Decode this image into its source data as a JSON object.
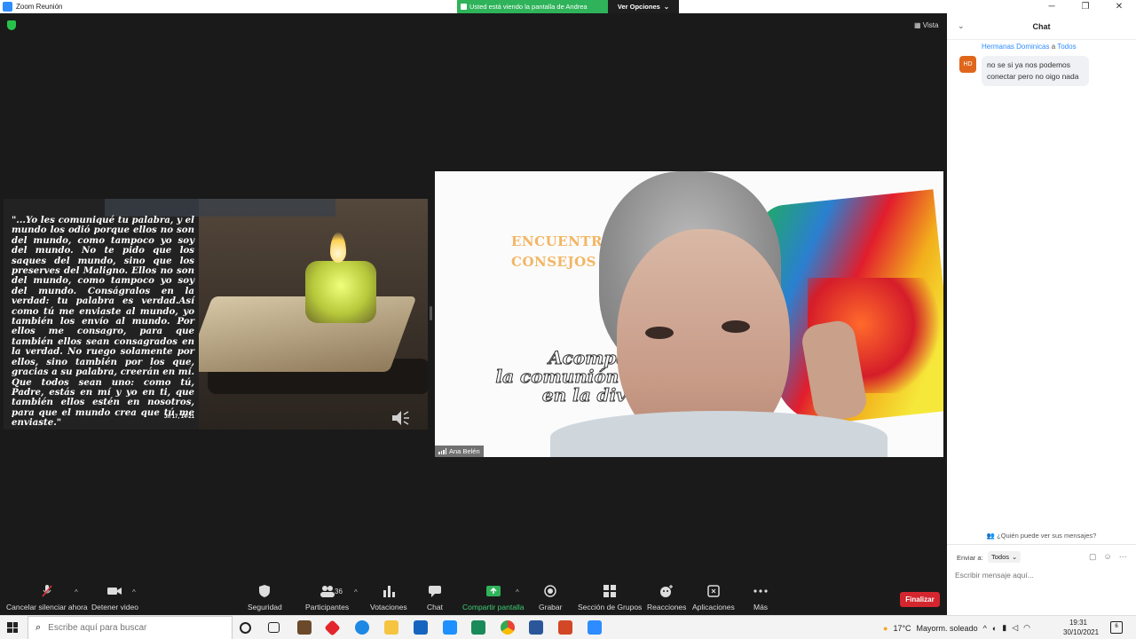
{
  "window": {
    "title": "Zoom Reunión",
    "share_banner": "Usted está viendo la pantalla de Andrea",
    "view_options": "Ver Opciones",
    "view_label": "Vista"
  },
  "shared_slide": {
    "verse": "\"...Yo les comuniqué tu palabra, y el mundo los odió porque ellos no son del mundo, como tampoco yo soy del mundo. No te pido que los saques del mundo, sino que los preserves del Maligno. Ellos no son del mundo, como tampoco yo soy del mundo. Conságralos en la verdad: tu palabra es verdad.Así como tú me enviaste al mundo, yo también los envío al mundo. Por ellos me consagro, para que también ellos sean consagrados en la verdad. No ruego solamente por ellos, sino también por los que, gracias a su palabra, creerán en mí. Que todos sean uno: como tú, Padre, estás en mí y yo en ti, que también ellos estén en nosotros, para que el mundo crea que tú me enviaste.\"",
    "reference": "Jn 17, 14-21"
  },
  "video_tile": {
    "participant_name": "Ana Belén",
    "bg_line1": "ENCUENTRO",
    "bg_line2": "CONSEJOS 2",
    "bg_phrase_1": "Acompañ",
    "bg_phrase_2": "la comunión congre",
    "bg_phrase_3": "en la diver"
  },
  "toolbar": {
    "mute": "Cancelar silenciar ahora",
    "stop_video": "Detener video",
    "security": "Seguridad",
    "participants": "Participantes",
    "participants_count": "36",
    "polls": "Votaciones",
    "chat": "Chat",
    "share": "Compartir pantalla",
    "record": "Grabar",
    "breakout": "Sección de Grupos",
    "reactions": "Reacciones",
    "apps": "Aplicaciones",
    "more": "Más",
    "end": "Finalizar"
  },
  "chat": {
    "title": "Chat",
    "messages": [
      {
        "sender": "Hermanas Dominicas",
        "to_word": "a",
        "recipient": "Todos",
        "avatar": "HD",
        "text": "no se si ya nos podemos conectar pero no oigo nada"
      }
    ],
    "who_can_see": "¿Quién puede ver sus mensajes?",
    "send_to_label": "Enviar a:",
    "send_to_value": "Todos",
    "input_placeholder": "Escribir mensaje aquí..."
  },
  "taskbar": {
    "search_placeholder": "Escribe aquí para buscar",
    "temperature": "17°C",
    "weather": "Mayorm. soleado",
    "time": "19:31",
    "date": "30/10/2021",
    "notification_count": "6"
  },
  "colors": {
    "share_green": "#2fb35a",
    "end_red": "#d3262e",
    "chat_link": "#2d8cff",
    "avatar_orange": "#e0661b"
  }
}
